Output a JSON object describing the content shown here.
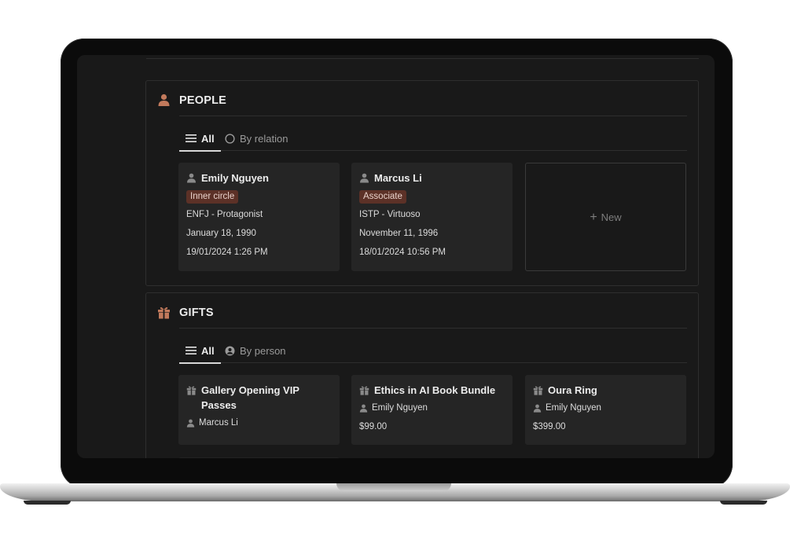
{
  "colors": {
    "accent": "#c27a5c",
    "tag_bg": "#5c3127",
    "screen_bg": "#191919",
    "card_bg": "#252525"
  },
  "people": {
    "icon": "person-icon",
    "title": "PEOPLE",
    "tabs": [
      {
        "label": "All",
        "icon": "list-icon",
        "active": true
      },
      {
        "label": "By relation",
        "icon": "circle-icon",
        "active": false
      }
    ],
    "cards": [
      {
        "name": "Emily Nguyen",
        "tag": "Inner circle",
        "type": "ENFJ - Protagonist",
        "birthday": "January 18, 1990",
        "created": "19/01/2024 1:26 PM"
      },
      {
        "name": "Marcus Li",
        "tag": "Associate",
        "type": "ISTP - Virtuoso",
        "birthday": "November 11, 1996",
        "created": "18/01/2024 10:56 PM"
      }
    ],
    "new_label": "New"
  },
  "gifts": {
    "icon": "gift-icon",
    "title": "GIFTS",
    "tabs": [
      {
        "label": "All",
        "icon": "list-icon",
        "active": true
      },
      {
        "label": "By person",
        "icon": "person-circle-icon",
        "active": false
      }
    ],
    "cards": [
      {
        "title_line1": "Gallery Opening VIP",
        "title_line2": "Passes",
        "person": "Marcus Li",
        "price": ""
      },
      {
        "title_line1": "Ethics in AI Book Bundle",
        "title_line2": "",
        "person": "Emily Nguyen",
        "price": "$99.00"
      },
      {
        "title_line1": "Oura Ring",
        "title_line2": "",
        "person": "Emily Nguyen",
        "price": "$399.00"
      }
    ]
  }
}
